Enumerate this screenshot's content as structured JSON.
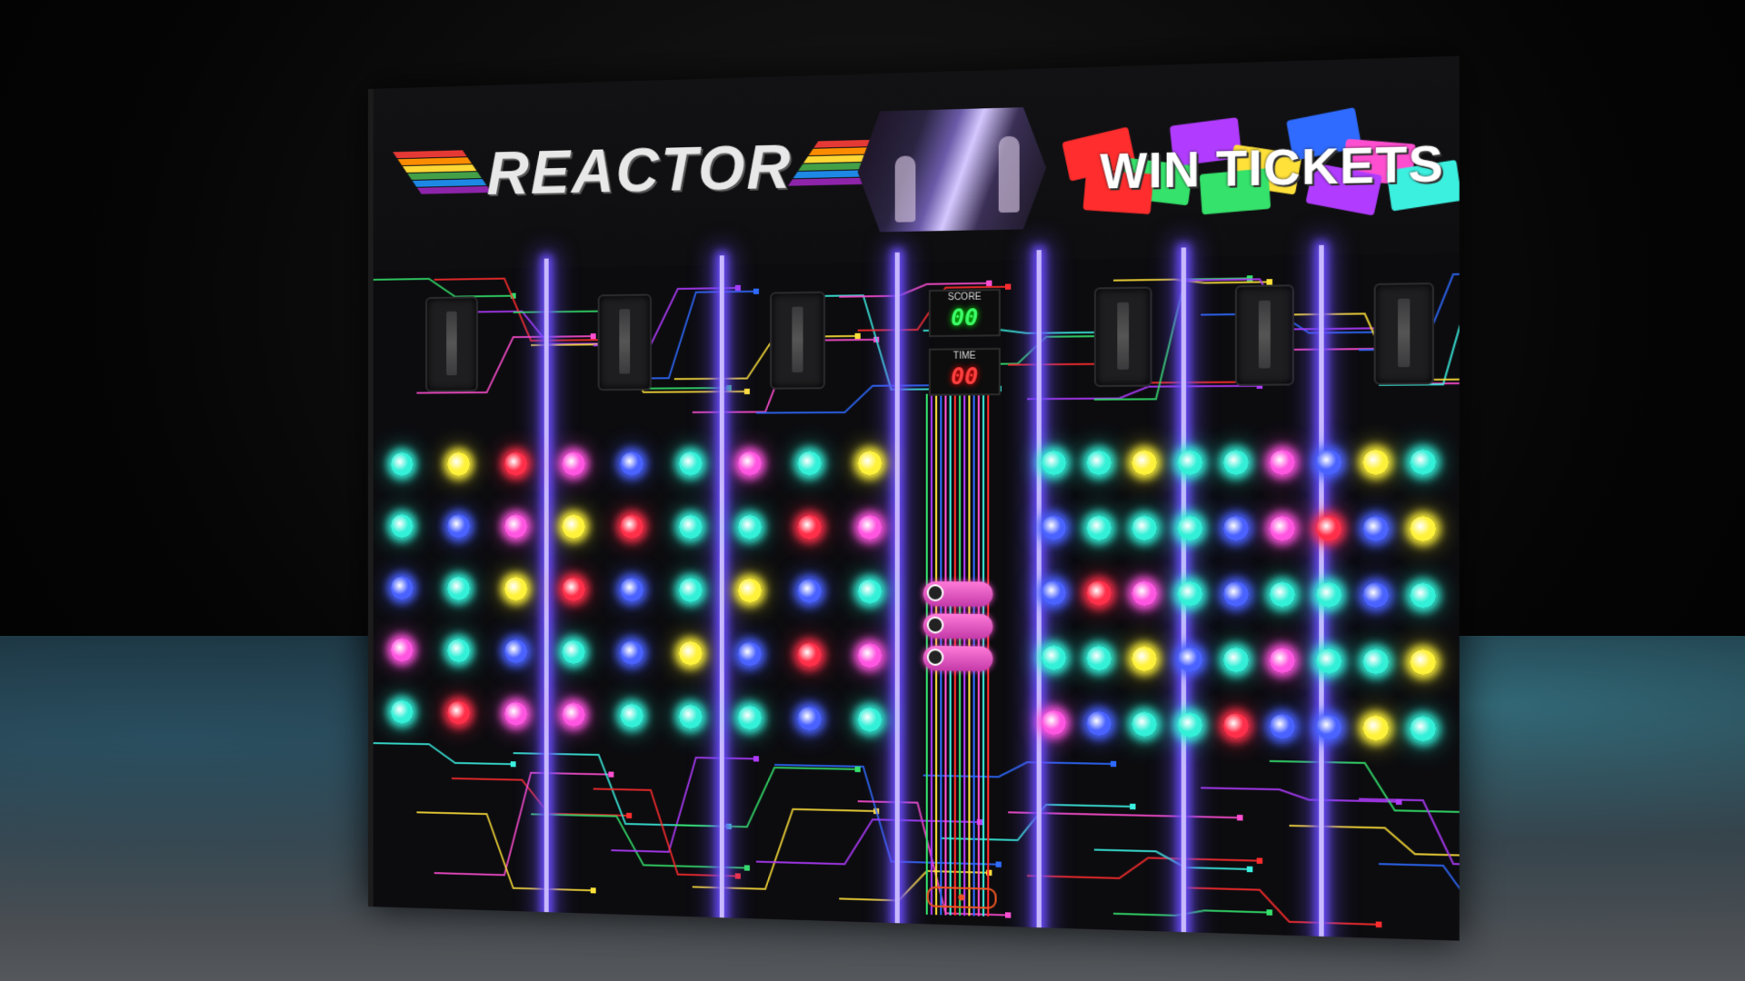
{
  "marquee": {
    "title": "REACTOR",
    "tickets_text": "WIN TICKETS"
  },
  "displays": {
    "score_label": "SCORE",
    "score_value": "00",
    "time_label": "TIME",
    "time_value": "00"
  },
  "colors": {
    "rainbow_stripes": [
      "#e53935",
      "#fb8c00",
      "#fdd835",
      "#43a047",
      "#1e88e5",
      "#8e24aa"
    ],
    "ticket_colors": [
      "#ff2d2d",
      "#35e26b",
      "#b13cff",
      "#ffe13a",
      "#2f6bff",
      "#ff4fd0",
      "#3cf0e0"
    ],
    "light_colors": {
      "c": "#33f0d8",
      "y": "#fff23a",
      "r": "#ff2f4a",
      "m": "#ff55e0",
      "b": "#4a62ff"
    },
    "neon": "#6a4dff"
  },
  "light_grid": {
    "left": [
      [
        "c",
        "y",
        "r",
        "m",
        "b",
        "c",
        "m",
        "c",
        "y"
      ],
      [
        "c",
        "b",
        "m",
        "y",
        "r",
        "c",
        "c",
        "r",
        "m"
      ],
      [
        "b",
        "c",
        "y",
        "r",
        "b",
        "c",
        "y",
        "b",
        "c"
      ],
      [
        "m",
        "c",
        "b",
        "c",
        "b",
        "y",
        "b",
        "r",
        "m"
      ],
      [
        "c",
        "r",
        "m",
        "m",
        "c",
        "c",
        "c",
        "b",
        "c"
      ]
    ],
    "right": [
      [
        "c",
        "c",
        "y",
        "c",
        "c",
        "m",
        "b",
        "y",
        "c"
      ],
      [
        "b",
        "c",
        "c",
        "c",
        "b",
        "m",
        "r",
        "b",
        "y"
      ],
      [
        "b",
        "r",
        "m",
        "c",
        "b",
        "c",
        "c",
        "b",
        "c"
      ],
      [
        "c",
        "c",
        "y",
        "b",
        "c",
        "m",
        "c",
        "c",
        "y"
      ],
      [
        "m",
        "b",
        "c",
        "c",
        "r",
        "b",
        "b",
        "y",
        "c"
      ]
    ]
  },
  "game_modes": [
    {
      "icon": "color-rush-icon"
    },
    {
      "icon": "color-chase-icon"
    },
    {
      "icon": "color-clash-icon"
    }
  ],
  "slots_count": 6
}
